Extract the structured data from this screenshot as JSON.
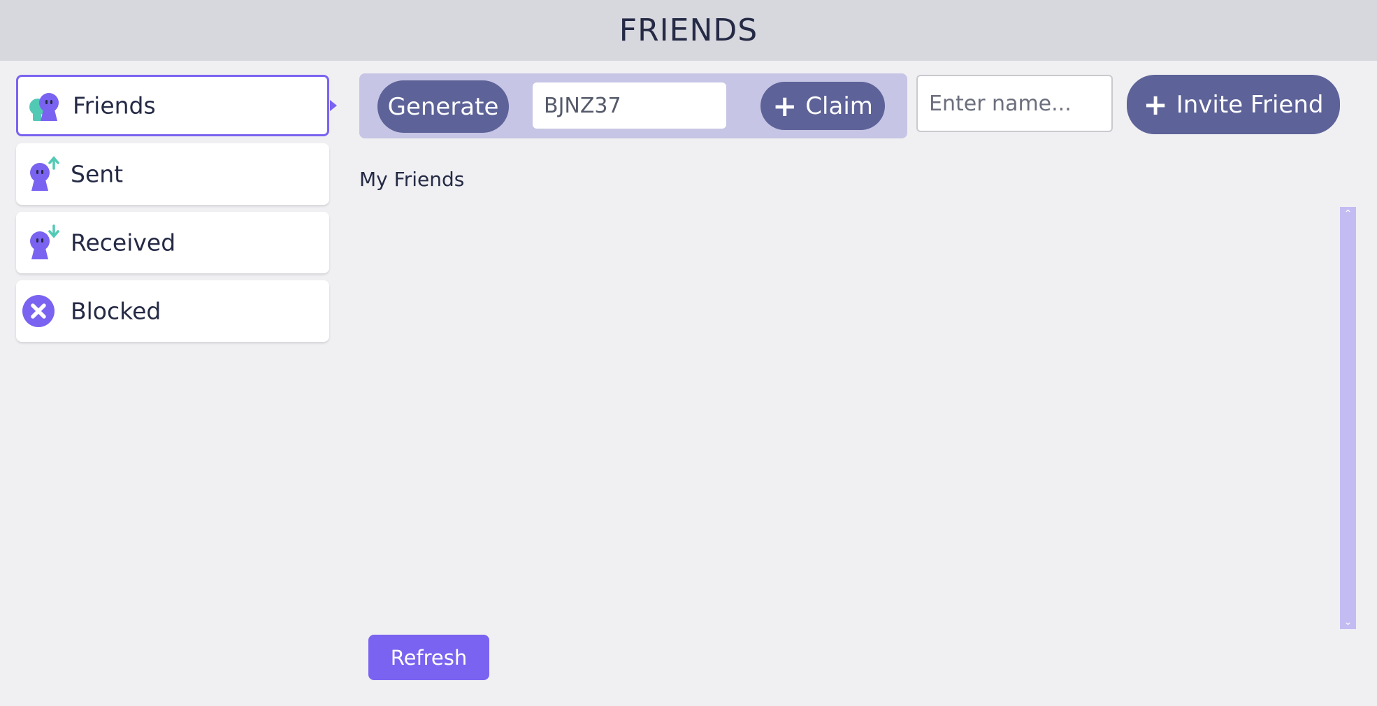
{
  "header": {
    "title": "FRIENDS"
  },
  "sidebar": {
    "items": [
      {
        "label": "Friends",
        "icon": "friends-icon",
        "active": true
      },
      {
        "label": "Sent",
        "icon": "sent-request-icon",
        "active": false
      },
      {
        "label": "Received",
        "icon": "received-request-icon",
        "active": false
      },
      {
        "label": "Blocked",
        "icon": "blocked-icon",
        "active": false
      }
    ]
  },
  "code_panel": {
    "generate_label": "Generate",
    "code_value": "BJNZ37",
    "claim_label": "Claim"
  },
  "invite": {
    "name_placeholder": "Enter name...",
    "invite_label": "Invite Friend"
  },
  "main": {
    "section_title": "My Friends",
    "friends": []
  },
  "footer": {
    "refresh_label": "Refresh"
  },
  "colors": {
    "accent": "#7a63f0",
    "teal": "#52c9b4",
    "button_dark": "#5d6298",
    "panel": "#c7c5e5",
    "header_bg": "#d7d7de",
    "scrollbar": "#c3bcf2"
  }
}
